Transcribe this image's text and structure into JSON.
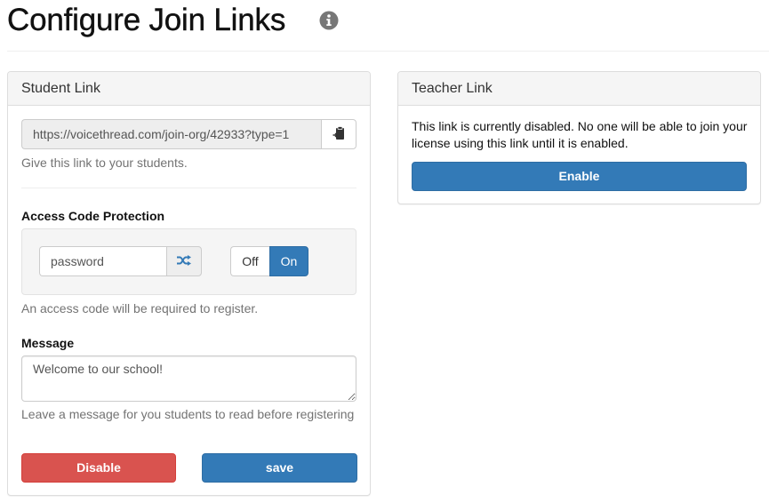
{
  "header": {
    "title": "Configure Join Links",
    "info_icon": "info-circle-icon"
  },
  "student_panel": {
    "title": "Student Link",
    "link_url": "https://voicethread.com/join-org/42933?type=1",
    "copy_icon": "clipboard-icon",
    "link_help": "Give this link to your students.",
    "access_code": {
      "label": "Access Code Protection",
      "value": "password",
      "shuffle_icon": "random-icon",
      "toggle_off_label": "Off",
      "toggle_on_label": "On",
      "toggle_state": "On",
      "help": "An access code will be required to register."
    },
    "message": {
      "label": "Message",
      "value": "Welcome to our school!",
      "help": "Leave a message for you students to read before registering"
    },
    "disable_label": "Disable",
    "save_label": "save"
  },
  "teacher_panel": {
    "title": "Teacher Link",
    "status_text": "This link is currently disabled. No one will be able to join your license using this link until it is enabled.",
    "enable_label": "Enable"
  },
  "colors": {
    "primary": "#337ab7",
    "danger": "#d9534f"
  }
}
